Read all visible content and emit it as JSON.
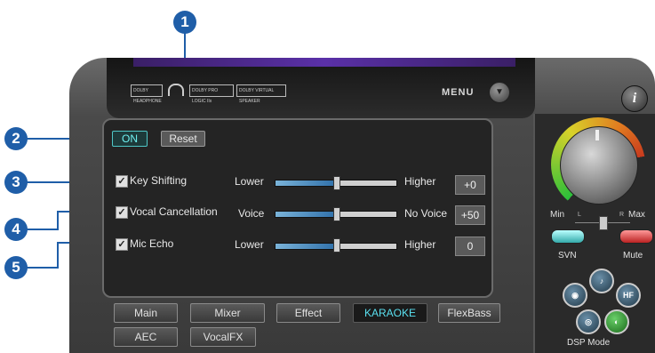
{
  "callouts": [
    "1",
    "2",
    "3",
    "4",
    "5"
  ],
  "header": {
    "logos": [
      "DOLBY HEADPHONE",
      "DOLBY PRO LOGIC IIx",
      "DOLBY VIRTUAL SPEAKER"
    ],
    "menu_label": "MENU",
    "info_label": "i"
  },
  "controls": {
    "on_label": "ON",
    "reset_label": "Reset"
  },
  "rows": [
    {
      "label": "Key Shifting",
      "checked": true,
      "left": "Lower",
      "right": "Higher",
      "value": "+0",
      "level": 0.5
    },
    {
      "label": "Vocal Cancellation",
      "checked": true,
      "left": "Voice",
      "right": "No Voice",
      "value": "+50",
      "level": 0.5
    },
    {
      "label": "Mic Echo",
      "checked": true,
      "left": "Lower",
      "right": "Higher",
      "value": "0",
      "level": 0.5
    }
  ],
  "tabs": [
    {
      "label": "Main",
      "active": false
    },
    {
      "label": "Mixer",
      "active": false
    },
    {
      "label": "Effect",
      "active": false
    },
    {
      "label": "KARAOKE",
      "active": true
    },
    {
      "label": "FlexBass",
      "active": false
    },
    {
      "label": "AEC",
      "active": false
    },
    {
      "label": "VocalFX",
      "active": false
    }
  ],
  "volume": {
    "min_label": "Min",
    "max_label": "Max",
    "l_label": "L",
    "r_label": "R",
    "svn_label": "SVN",
    "mute_label": "Mute"
  },
  "dsp": {
    "label": "DSP Mode",
    "hf_label": "HF"
  },
  "colors": {
    "callout": "#1f5ea8",
    "active_tab": "#5ae0f0",
    "on_button": "#6ff0f0"
  }
}
